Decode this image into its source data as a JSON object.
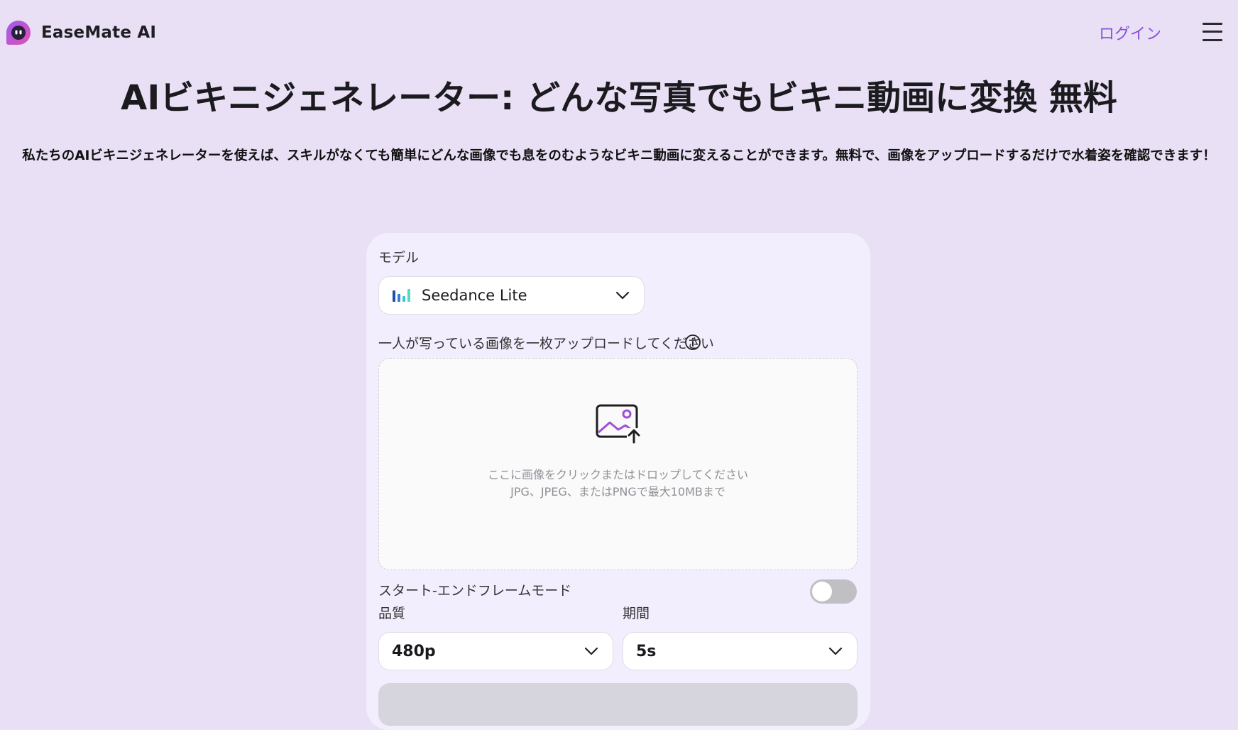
{
  "header": {
    "brand": "EaseMate AI",
    "login": "ログイン",
    "menu_icon": "hamburger-menu-icon",
    "brand_color": "#8a4fd6"
  },
  "hero": {
    "title": "AIビキニジェネレーター: どんな写真でもビキニ動画に変換 無料",
    "subtitle": "私たちのAIビキニジェネレーターを使えば、スキルがなくても簡単にどんな画像でも息をのむようなビキニ動画に変えることができます。無料で、画像をアップロードするだけで水着姿を確認できます！"
  },
  "form": {
    "model_label": "モデル",
    "model_value": "Seedance Lite",
    "upload_label": "一人が写っている画像を一枚アップロードしてください",
    "upload_hint_1": "ここに画像をクリックまたはドロップしてください",
    "upload_hint_2": "JPG、JPEG、またはPNGで最大10MBまで",
    "start_end_label": "スタート-エンドフレームモード",
    "start_end_enabled": false,
    "quality_label": "品質",
    "quality_value": "480p",
    "duration_label": "期間",
    "duration_value": "5s"
  }
}
